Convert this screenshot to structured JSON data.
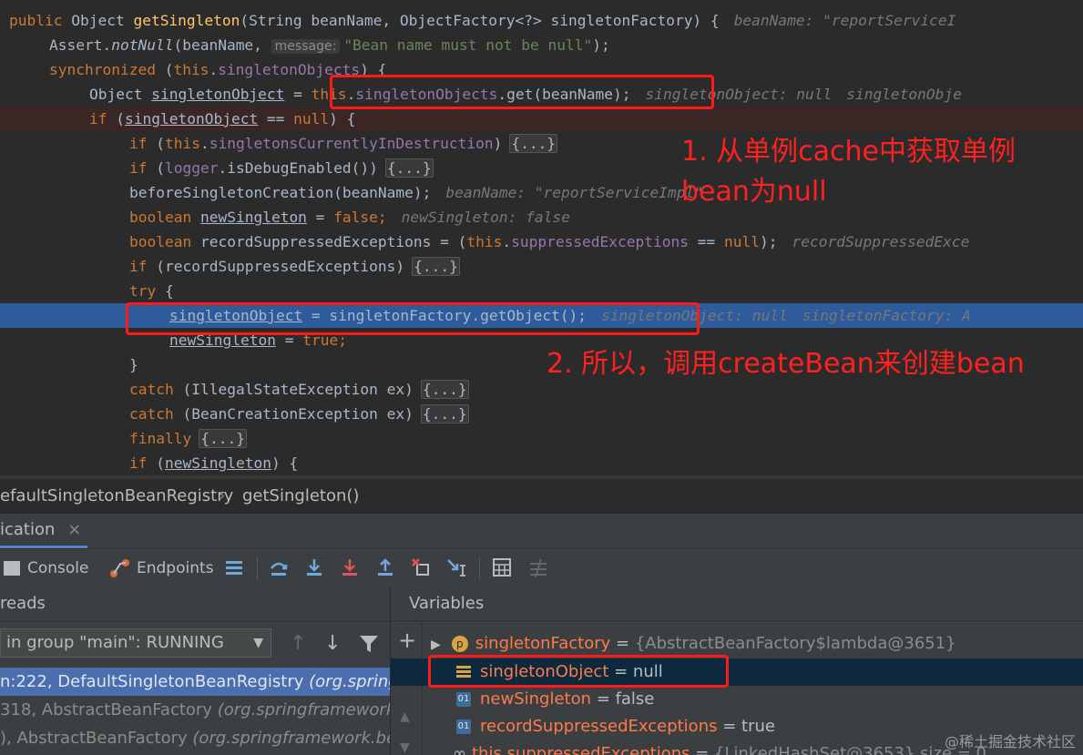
{
  "code": {
    "l1": {
      "kw": "public",
      "type": " Object ",
      "fn": "getSingleton",
      "args": "(String beanName, ObjectFactory<?> singletonFactory) {",
      "hint": "beanName: \"reportServiceI"
    },
    "l2": {
      "pre": "Assert.",
      "m": "notNull",
      "a": "(beanName, ",
      "param": "message:",
      "str": "\"Bean name must not be null\"",
      "post": ");"
    },
    "l3": {
      "kw": "synchronized",
      "a": " (",
      "this": "this",
      "dot": ".",
      "fld": "singletonObjects",
      "post": ") {"
    },
    "l4": {
      "pre": "Object ",
      "var": "singletonObject",
      "eq": " = ",
      "this": "this",
      "dot": ".",
      "fld": "singletonObjects",
      "post": ".get(beanName);",
      "hint1": "singletonObject: null",
      "hint2": "singletonObje"
    },
    "l5": {
      "kw": "if",
      "a": " (",
      "var": "singletonObject",
      "post": " == ",
      "null": "null",
      "end": ") {"
    },
    "l6": {
      "kw": "if",
      "a": " (",
      "this": "this",
      "dot": ".",
      "fld": "singletonsCurrentlyInDestruction",
      "post": ")",
      "fold": "{...}"
    },
    "l7": {
      "kw": "if",
      "a": " (",
      "fld": "logger",
      "post": ".isDebugEnabled())",
      "fold": "{...}"
    },
    "l8": {
      "pre": "beforeSingletonCreation(beanName);",
      "hint": "beanName: \"reportServiceImpl\""
    },
    "l9": {
      "kw": "boolean",
      "sp": " ",
      "var": "newSingleton",
      "eq": " = ",
      "val": "false",
      "semi": ";",
      "hint": "newSingleton: false"
    },
    "l10": {
      "kw": "boolean",
      "pre": " recordSuppressedExceptions = (",
      "this": "this",
      "dot": ".",
      "fld": "suppressedExceptions",
      "post": " == ",
      "null": "null",
      "end": ");",
      "hint": "recordSuppressedExce"
    },
    "l11": {
      "kw": "if",
      "post": " (recordSuppressedExceptions)",
      "fold": "{...}"
    },
    "l12": {
      "kw": "try",
      "post": " {"
    },
    "l13": {
      "var": "singletonObject",
      "post": " = singletonFactory.getObject();",
      "hint1": "singletonObject: null",
      "hint2": "singletonFactory: A"
    },
    "l14": {
      "var": "newSingleton",
      "eq": " = ",
      "val": "true",
      "semi": ";"
    },
    "l15": {
      "post": "}"
    },
    "l16": {
      "kw": "catch",
      "post": " (IllegalStateException ex)",
      "fold": "{...}"
    },
    "l17": {
      "kw": "catch",
      "post": " (BeanCreationException ex)",
      "fold": "{...}"
    },
    "l18": {
      "kw": "finally",
      "fold": "{...}"
    },
    "l19": {
      "kw": "if",
      "a": " (",
      "var": "newSingleton",
      "post": ") {"
    }
  },
  "annotations": {
    "note1_line1": "1. 从单例cache中获取单例",
    "note1_line2": "bean为null",
    "note2": "2. 所以，调用createBean来创建bean"
  },
  "breadcrumb": {
    "class": "efaultSingletonBeanRegistry",
    "sep": "›",
    "method": "getSingleton()"
  },
  "debug_tab": {
    "label": "ication",
    "close": "×"
  },
  "toolbar": {
    "console": "Console",
    "endpoints": "Endpoints"
  },
  "threads": {
    "title": "reads",
    "selector": "in group \"main\": RUNNING",
    "frames": [
      {
        "loc": "n:222, DefaultSingletonBeanRegistry ",
        "cls": "(org.springfra"
      },
      {
        "loc": "318, AbstractBeanFactory ",
        "cls": "(org.springframework.be"
      },
      {
        "loc": "), AbstractBeanFactory ",
        "cls": "(org.springframework.bean"
      }
    ]
  },
  "variables": {
    "title": "Variables",
    "items": [
      {
        "name": "singletonFactory",
        "eq": " = ",
        "value": "{AbstractBeanFactory$lambda@3651}"
      },
      {
        "name": "singletonObject",
        "eq": " = ",
        "value": "null"
      },
      {
        "name": "newSingleton",
        "eq": " = ",
        "value": "false"
      },
      {
        "name": "recordSuppressedExceptions",
        "eq": " = ",
        "value": "true"
      },
      {
        "name": "this.suppressedExceptions",
        "eq": " = ",
        "value": "{LinkedHashSet@3653}  size = 0"
      }
    ]
  },
  "watermark": "@稀土掘金技术社区"
}
